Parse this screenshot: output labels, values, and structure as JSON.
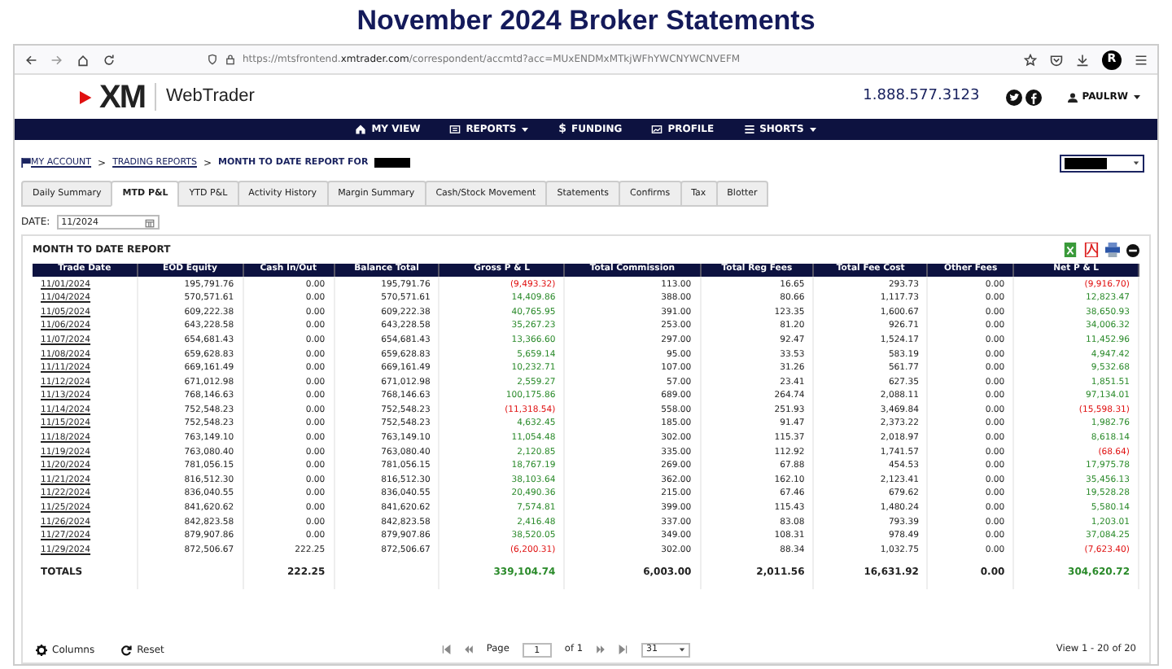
{
  "page_title": "November 2024 Broker Statements",
  "browser": {
    "url": "https://mtsfrontend.**xmtrader.com**/correspondent/accmtd?acc=MUxENDMxMTkjWFhYWCNYWCNVEFM",
    "profile_initial": "R"
  },
  "header": {
    "logo": "XM",
    "product": "WebTrader",
    "phone": "1.888.577.3123",
    "user": "PAULRW"
  },
  "nav": [
    {
      "label": "MY VIEW",
      "dropdown": false
    },
    {
      "label": "REPORTS",
      "dropdown": true
    },
    {
      "label": "FUNDING",
      "glyph": "$",
      "dropdown": false
    },
    {
      "label": "PROFILE",
      "dropdown": false
    },
    {
      "label": "SHORTS",
      "dropdown": true
    }
  ],
  "breadcrumb_separator": ">",
  "breadcrumb": [
    {
      "label": "MY ACCOUNT",
      "link": true
    },
    {
      "label": "TRADING REPORTS",
      "link": true
    },
    {
      "label": "MONTH TO DATE REPORT FOR",
      "link": false
    }
  ],
  "tabs": [
    {
      "label": "Daily Summary",
      "selected": false
    },
    {
      "label": "MTD P&L",
      "selected": true
    },
    {
      "label": "YTD P&L",
      "selected": false
    },
    {
      "label": "Activity History",
      "selected": false
    },
    {
      "label": "Margin Summary",
      "selected": false
    },
    {
      "label": "Cash/Stock Movement",
      "selected": false
    },
    {
      "label": "Statements",
      "selected": false
    },
    {
      "label": "Confirms",
      "selected": false
    },
    {
      "label": "Tax",
      "selected": false
    },
    {
      "label": "Blotter",
      "selected": false
    }
  ],
  "date_filter": {
    "label": "DATE:",
    "value": "11/2024"
  },
  "report": {
    "title": "MONTH TO DATE REPORT",
    "columns": [
      "Trade Date",
      "EOD Equity",
      "Cash In/Out",
      "Balance Total",
      "Gross P & L",
      "Total Commission",
      "Total Reg Fees",
      "Total Fee Cost",
      "Other Fees",
      "Net P & L"
    ],
    "rows": [
      {
        "date": "11/01/2024",
        "eod": "195,791.76",
        "cash": "0.00",
        "balance": "195,791.76",
        "gross": "(9,493.32)",
        "gross_loss": true,
        "commission": "113.00",
        "reg": "16.65",
        "fee_cost": "293.73",
        "other": "0.00",
        "net": "(9,916.70)",
        "net_loss": true
      },
      {
        "date": "11/04/2024",
        "eod": "570,571.61",
        "cash": "0.00",
        "balance": "570,571.61",
        "gross": "14,409.86",
        "gross_loss": false,
        "commission": "388.00",
        "reg": "80.66",
        "fee_cost": "1,117.73",
        "other": "0.00",
        "net": "12,823.47",
        "net_loss": false
      },
      {
        "date": "11/05/2024",
        "eod": "609,222.38",
        "cash": "0.00",
        "balance": "609,222.38",
        "gross": "40,765.95",
        "gross_loss": false,
        "commission": "391.00",
        "reg": "123.35",
        "fee_cost": "1,600.67",
        "other": "0.00",
        "net": "38,650.93",
        "net_loss": false
      },
      {
        "date": "11/06/2024",
        "eod": "643,228.58",
        "cash": "0.00",
        "balance": "643,228.58",
        "gross": "35,267.23",
        "gross_loss": false,
        "commission": "253.00",
        "reg": "81.20",
        "fee_cost": "926.71",
        "other": "0.00",
        "net": "34,006.32",
        "net_loss": false
      },
      {
        "date": "11/07/2024",
        "eod": "654,681.43",
        "cash": "0.00",
        "balance": "654,681.43",
        "gross": "13,366.60",
        "gross_loss": false,
        "commission": "297.00",
        "reg": "92.47",
        "fee_cost": "1,524.17",
        "other": "0.00",
        "net": "11,452.96",
        "net_loss": false
      },
      {
        "date": "11/08/2024",
        "eod": "659,628.83",
        "cash": "0.00",
        "balance": "659,628.83",
        "gross": "5,659.14",
        "gross_loss": false,
        "commission": "95.00",
        "reg": "33.53",
        "fee_cost": "583.19",
        "other": "0.00",
        "net": "4,947.42",
        "net_loss": false
      },
      {
        "date": "11/11/2024",
        "eod": "669,161.49",
        "cash": "0.00",
        "balance": "669,161.49",
        "gross": "10,232.71",
        "gross_loss": false,
        "commission": "107.00",
        "reg": "31.26",
        "fee_cost": "561.77",
        "other": "0.00",
        "net": "9,532.68",
        "net_loss": false
      },
      {
        "date": "11/12/2024",
        "eod": "671,012.98",
        "cash": "0.00",
        "balance": "671,012.98",
        "gross": "2,559.27",
        "gross_loss": false,
        "commission": "57.00",
        "reg": "23.41",
        "fee_cost": "627.35",
        "other": "0.00",
        "net": "1,851.51",
        "net_loss": false
      },
      {
        "date": "11/13/2024",
        "eod": "768,146.63",
        "cash": "0.00",
        "balance": "768,146.63",
        "gross": "100,175.86",
        "gross_loss": false,
        "commission": "689.00",
        "reg": "264.74",
        "fee_cost": "2,088.11",
        "other": "0.00",
        "net": "97,134.01",
        "net_loss": false
      },
      {
        "date": "11/14/2024",
        "eod": "752,548.23",
        "cash": "0.00",
        "balance": "752,548.23",
        "gross": "(11,318.54)",
        "gross_loss": true,
        "commission": "558.00",
        "reg": "251.93",
        "fee_cost": "3,469.84",
        "other": "0.00",
        "net": "(15,598.31)",
        "net_loss": true
      },
      {
        "date": "11/15/2024",
        "eod": "752,548.23",
        "cash": "0.00",
        "balance": "752,548.23",
        "gross": "4,632.45",
        "gross_loss": false,
        "commission": "185.00",
        "reg": "91.47",
        "fee_cost": "2,373.22",
        "other": "0.00",
        "net": "1,982.76",
        "net_loss": false
      },
      {
        "date": "11/18/2024",
        "eod": "763,149.10",
        "cash": "0.00",
        "balance": "763,149.10",
        "gross": "11,054.48",
        "gross_loss": false,
        "commission": "302.00",
        "reg": "115.37",
        "fee_cost": "2,018.97",
        "other": "0.00",
        "net": "8,618.14",
        "net_loss": false
      },
      {
        "date": "11/19/2024",
        "eod": "763,080.40",
        "cash": "0.00",
        "balance": "763,080.40",
        "gross": "2,120.85",
        "gross_loss": false,
        "commission": "335.00",
        "reg": "112.92",
        "fee_cost": "1,741.57",
        "other": "0.00",
        "net": "(68.64)",
        "net_loss": true
      },
      {
        "date": "11/20/2024",
        "eod": "781,056.15",
        "cash": "0.00",
        "balance": "781,056.15",
        "gross": "18,767.19",
        "gross_loss": false,
        "commission": "269.00",
        "reg": "67.88",
        "fee_cost": "454.53",
        "other": "0.00",
        "net": "17,975.78",
        "net_loss": false
      },
      {
        "date": "11/21/2024",
        "eod": "816,512.30",
        "cash": "0.00",
        "balance": "816,512.30",
        "gross": "38,103.64",
        "gross_loss": false,
        "commission": "362.00",
        "reg": "162.10",
        "fee_cost": "2,123.41",
        "other": "0.00",
        "net": "35,456.13",
        "net_loss": false
      },
      {
        "date": "11/22/2024",
        "eod": "836,040.55",
        "cash": "0.00",
        "balance": "836,040.55",
        "gross": "20,490.36",
        "gross_loss": false,
        "commission": "215.00",
        "reg": "67.46",
        "fee_cost": "679.62",
        "other": "0.00",
        "net": "19,528.28",
        "net_loss": false
      },
      {
        "date": "11/25/2024",
        "eod": "841,620.62",
        "cash": "0.00",
        "balance": "841,620.62",
        "gross": "7,574.81",
        "gross_loss": false,
        "commission": "399.00",
        "reg": "115.43",
        "fee_cost": "1,480.24",
        "other": "0.00",
        "net": "5,580.14",
        "net_loss": false
      },
      {
        "date": "11/26/2024",
        "eod": "842,823.58",
        "cash": "0.00",
        "balance": "842,823.58",
        "gross": "2,416.48",
        "gross_loss": false,
        "commission": "337.00",
        "reg": "83.08",
        "fee_cost": "793.39",
        "other": "0.00",
        "net": "1,203.01",
        "net_loss": false
      },
      {
        "date": "11/27/2024",
        "eod": "879,907.86",
        "cash": "0.00",
        "balance": "879,907.86",
        "gross": "38,520.05",
        "gross_loss": false,
        "commission": "349.00",
        "reg": "108.31",
        "fee_cost": "978.49",
        "other": "0.00",
        "net": "37,084.25",
        "net_loss": false
      },
      {
        "date": "11/29/2024",
        "eod": "872,506.67",
        "cash": "222.25",
        "balance": "872,506.67",
        "gross": "(6,200.31)",
        "gross_loss": true,
        "commission": "302.00",
        "reg": "88.34",
        "fee_cost": "1,032.75",
        "other": "0.00",
        "net": "(7,623.40)",
        "net_loss": true
      }
    ],
    "totals": {
      "label": "TOTALS",
      "cash": "222.25",
      "gross": "339,104.74",
      "commission": "6,003.00",
      "reg": "2,011.56",
      "fee_cost": "16,631.92",
      "other": "0.00",
      "net": "304,620.72"
    }
  },
  "footer": {
    "columns_button": "Columns",
    "reset_button": "Reset",
    "page_label": "Page",
    "page": "1",
    "page_of": "of 1",
    "page_size": "31",
    "view_info": "View 1 - 20 of 20"
  }
}
